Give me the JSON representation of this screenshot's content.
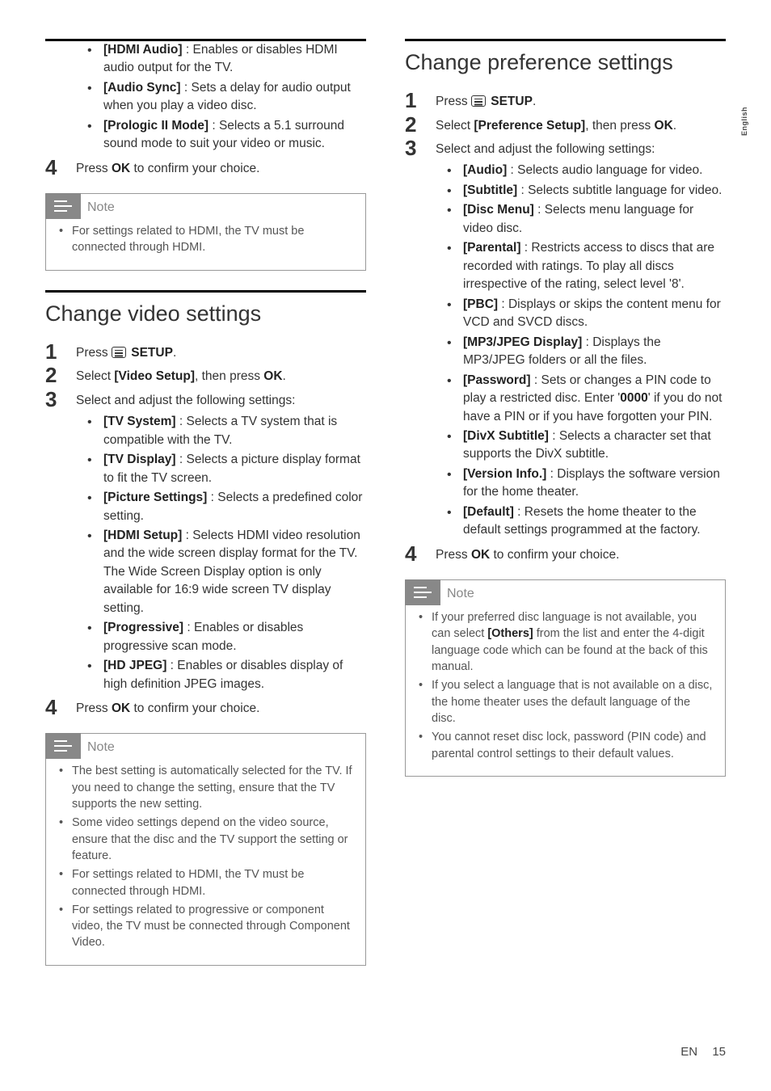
{
  "sideTab": "English",
  "footer": {
    "lang": "EN",
    "page": "15"
  },
  "noteLabel": "Note",
  "left": {
    "continuationBullets": [
      {
        "label": "[HDMI Audio]",
        "desc": " : Enables or disables HDMI audio output for the TV."
      },
      {
        "label": "[Audio Sync]",
        "desc": " : Sets a delay for audio output when you play a video disc."
      },
      {
        "label": "[Prologic II Mode]",
        "desc": " : Selects a 5.1 surround sound mode to suit your video or music."
      }
    ],
    "step4": {
      "prefix": "Press ",
      "bold": "OK",
      "suffix": " to confirm your choice."
    },
    "note1": [
      "For settings related to HDMI, the TV must be connected through HDMI."
    ],
    "h2a": "Change video settings",
    "videoSteps": {
      "s1": {
        "prefix": "Press ",
        "icon": true,
        "bold": "SETUP",
        "suffix": "."
      },
      "s2": {
        "prefix": "Select ",
        "bold": "[Video Setup]",
        "mid": ", then press ",
        "bold2": "OK",
        "suffix": "."
      },
      "s3": {
        "text": "Select and adjust the following settings:",
        "bullets": [
          {
            "label": "[TV System]",
            "desc": " : Selects a TV system that is compatible with the TV."
          },
          {
            "label": "[TV Display]",
            "desc": " : Selects a picture display format to fit the TV screen."
          },
          {
            "label": "[Picture Settings]",
            "desc": " : Selects a predefined color setting."
          },
          {
            "label": "[HDMI Setup]",
            "desc": " : Selects HDMI video resolution and the wide screen display format for the TV. The Wide Screen Display option is only available for 16:9 wide screen TV display setting."
          },
          {
            "label": "[Progressive]",
            "desc": " : Enables or disables progressive scan mode."
          },
          {
            "label": "[HD JPEG]",
            "desc": " : Enables or disables display of high definition JPEG images."
          }
        ]
      },
      "s4": {
        "prefix": "Press ",
        "bold": "OK",
        "suffix": " to confirm your choice."
      }
    },
    "note2": [
      "The best setting is automatically selected for the TV. If you need to change the setting, ensure that the TV supports the new setting.",
      "Some video settings depend on the video source, ensure that the disc and the TV support the setting or feature.",
      "For settings related to HDMI, the TV must be connected through HDMI.",
      "For settings related to progressive or component video, the TV must be connected through Component Video."
    ]
  },
  "right": {
    "h2": "Change preference settings",
    "steps": {
      "s1": {
        "prefix": "Press ",
        "icon": true,
        "bold": "SETUP",
        "suffix": "."
      },
      "s2": {
        "prefix": "Select ",
        "bold": "[Preference Setup]",
        "mid": ", then press ",
        "bold2": "OK",
        "suffix": "."
      },
      "s3": {
        "text": "Select and adjust the following settings:",
        "bullets": [
          {
            "label": "[Audio]",
            "desc": " : Selects audio language for video."
          },
          {
            "label": "[Subtitle]",
            "desc": " : Selects subtitle language for video."
          },
          {
            "label": "[Disc Menu]",
            "desc": " : Selects menu language for video disc."
          },
          {
            "label": "[Parental]",
            "desc": " : Restricts access to discs that are recorded with ratings. To play all discs irrespective of the rating, select level '8'."
          },
          {
            "label": "[PBC]",
            "desc": " : Displays or skips the content menu for VCD and SVCD discs."
          },
          {
            "label": "[MP3/JPEG Display]",
            "desc": " : Displays the MP3/JPEG folders or all the files."
          },
          {
            "label": "[Password]",
            "desc1": " : Sets or changes a PIN code to play a restricted disc. Enter '",
            "bold2": "0000",
            "desc2": "' if you do not have a PIN or if you have forgotten your PIN."
          },
          {
            "label": "[DivX Subtitle]",
            "desc": " : Selects a character set that supports the DivX subtitle."
          },
          {
            "label": "[Version Info.]",
            "desc": " : Displays the software version for the home theater."
          },
          {
            "label": "[Default]",
            "desc": " : Resets the home theater to the default settings programmed at the factory."
          }
        ]
      },
      "s4": {
        "prefix": "Press ",
        "bold": "OK",
        "suffix": " to confirm your choice."
      }
    },
    "note": [
      {
        "pre": "If your preferred disc language is not available, you can select ",
        "bold": "[Others]",
        "post": " from the list and enter the 4-digit language code which can be found at the back of this manual."
      },
      {
        "pre": "If you select a language that is not available on a disc, the home theater uses the default language of the disc."
      },
      {
        "pre": "You cannot reset disc lock, password (PIN code) and parental control settings to their default values."
      }
    ]
  }
}
